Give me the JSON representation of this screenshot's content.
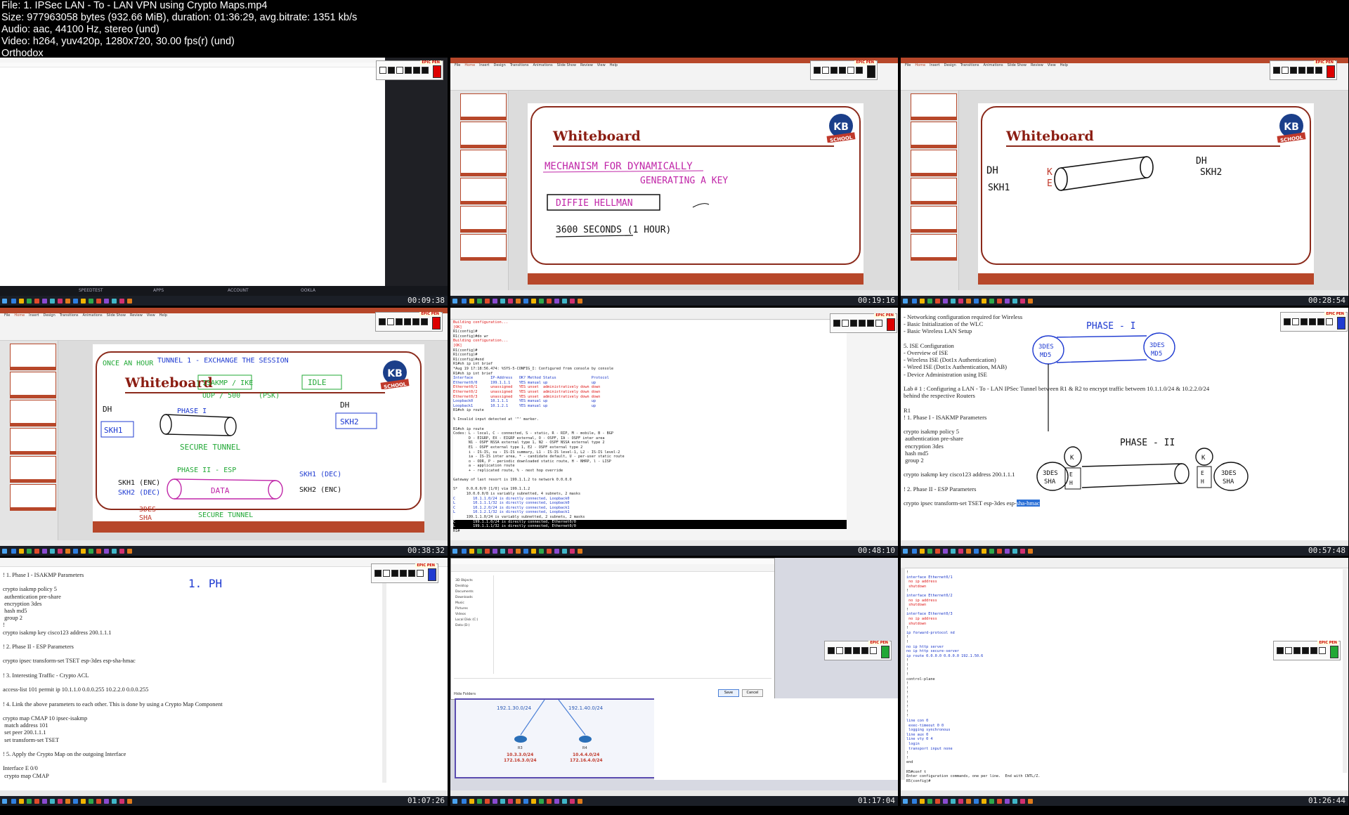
{
  "header": {
    "file_line": "File: 1. IPSec LAN - To - LAN VPN using Crypto Maps.mp4",
    "size_line": "Size: 977963058 bytes (932.66 MiB), duration: 01:36:29, avg.bitrate: 1351 kb/s",
    "audio_line": "Audio: aac, 44100 Hz, stereo (und)",
    "video_line": "Video: h264, yuv420p, 1280x720, 30.00 fps(r) (und)",
    "extra_line": "Orthodox"
  },
  "tiles": [
    {
      "timestamp": "00:09:38",
      "taskbar_labels": [
        "SPEEDTEST",
        "APPS",
        "ACCOUNT",
        "OOKLA"
      ]
    },
    {
      "timestamp": "00:19:16",
      "slide_title": "Whiteboard",
      "ink": [
        "MECHANISM FOR DYNAMICALLY",
        "GENERATING A KEY",
        "DIFFIE HELLMAN",
        "3600 SECONDS (1 HOUR)"
      ]
    },
    {
      "timestamp": "00:28:54",
      "slide_title": "Whiteboard",
      "ink": [
        "DH",
        "SKH1",
        "K",
        "E",
        "DH",
        "SKH2"
      ]
    },
    {
      "timestamp": "00:38:32",
      "slide_title": "Whiteboard",
      "ink": [
        "ONCE AN HOUR",
        "TUNNEL 1 - EXCHANGE THE SESSION",
        "ISAKMP / IKE",
        "UDP / 500",
        "(PSK)",
        "IDLE",
        "DH",
        "SKH1",
        "PHASE I",
        "SECURE TUNNEL",
        "PHASE II - ESP",
        "SKH1 (ENC)",
        "SKH2 (DEC)",
        "DATA",
        "SECURE TUNNEL",
        "3DES",
        "SHA",
        "SKH1 (DEC)",
        "SKH2 (ENC)",
        "DH",
        "SKH2"
      ]
    },
    {
      "timestamp": "00:48:10",
      "cli": [
        "Building configuration...",
        "[OK]",
        "R1(config)#",
        "R1(config)#do wr",
        "Building configuration...",
        "[OK]",
        "R1(config)#",
        "R1(config)#",
        "R1(config)#end",
        "R1#sh ip int brief",
        "*Aug 19 17:18:56.474: %SYS-5-CONFIG_I: Configured from console by console",
        "R1#sh ip int brief",
        "Interface        IP-Address   OK? Method Status                Protocol",
        "Ethernet0/0      199.1.1.1    YES manual up                    up",
        "Ethernet0/1      unassigned   YES unset  administratively down down",
        "Ethernet0/2      unassigned   YES unset  administratively down down",
        "Ethernet0/3      unassigned   YES unset  administratively down down",
        "Loopback0        10.1.1.1     YES manual up                    up",
        "Loopback1        10.1.2.1     YES manual up                    up",
        "R1#sh ip route",
        "",
        "% Invalid input detected at '^' marker.",
        "",
        "R1#sh ip route",
        "Codes: L - local, C - connected, S - static, R - RIP, M - mobile, B - BGP",
        "       D - EIGRP, EX - EIGRP external, O - OSPF, IA - OSPF inter area",
        "       N1 - OSPF NSSA external type 1, N2 - OSPF NSSA external type 2",
        "       E1 - OSPF external type 1, E2 - OSPF external type 2",
        "       i - IS-IS, su - IS-IS summary, L1 - IS-IS level-1, L2 - IS-IS level-2",
        "       ia - IS-IS inter area, * - candidate default, U - per-user static route",
        "       o - ODR, P - periodic downloaded static route, H - NHRP, l - LISP",
        "       a - application route",
        "       + - replicated route, % - next hop override",
        "",
        "Gateway of last resort is 199.1.1.2 to network 0.0.0.0",
        "",
        "S*    0.0.0.0/0 [1/0] via 199.1.1.2",
        "      10.0.0.0/8 is variably subnetted, 4 subnets, 2 masks",
        "C        10.1.1.0/24 is directly connected, Loopback0",
        "L        10.1.1.1/32 is directly connected, Loopback0",
        "C        10.1.2.0/24 is directly connected, Loopback1",
        "L        10.1.2.1/32 is directly connected, Loopback1",
        "      199.1.1.0/24 is variably subnetted, 2 subnets, 2 masks",
        "C        199.1.1.0/24 is directly connected, Ethernet0/0",
        "L        199.1.1.1/32 is directly connected, Ethernet0/0",
        "R1#"
      ]
    },
    {
      "timestamp": "00:57:48",
      "doc": [
        "- Networking configuration required for Wireless",
        "- Basic Initialization of the WLC",
        "- Basic Wireless LAN Setup",
        "",
        "5. ISE Configuration",
        "- Overview of ISE",
        "- Wireless ISE (Dot1x Authentication)",
        "- Wired ISE (Dot1x Authentication, MAB)",
        "- Device Administration using ISE",
        "",
        "Lab # 1 : Configuring a LAN - To - LAN IPSec Tunnel between R1 & R2 to encrypt traffic between 10.1.1.0/24 & 10.2.2.0/24",
        "behind the respective Routers",
        "",
        "R1",
        "! 1. Phase I - ISAKMP Parameters",
        "",
        "crypto isakmp policy 5",
        " authentication pre-share",
        " encryption 3des",
        " hash md5",
        " group 2",
        "",
        "crypto isakmp key cisco123 address 200.1.1.1",
        "",
        "! 2. Phase II - ESP Parameters",
        "",
        "crypto ipsec transform-set TSET esp-3des esp-"
      ],
      "doc_highlight": "sha-hmac",
      "ink": [
        "PHASE - I",
        "3DES",
        "MD5",
        "3DES",
        "MD5",
        "PHASE - II",
        "K",
        "E",
        "H",
        "3DES",
        "SHA",
        "K",
        "E",
        "H",
        "3DES",
        "SHA"
      ]
    },
    {
      "timestamp": "01:07:26",
      "doc": [
        "! 1. Phase I - ISAKMP Parameters",
        "",
        "crypto isakmp policy 5",
        " authentication pre-share",
        " encryption 3des",
        " hash md5",
        " group 2",
        "!",
        "crypto isakmp key cisco123 address 200.1.1.1",
        "",
        "! 2. Phase II - ESP Parameters",
        "",
        "crypto ipsec transform-set TSET esp-3des esp-sha-hmac",
        "",
        "! 3. Interesting Traffic - Crypto ACL",
        "",
        "access-list 101 permit ip 10.1.1.0 0.0.0.255 10.2.2.0 0.0.0.255",
        "",
        "! 4. Link the above parameters to each other. This is done by using a Crypto Map Component",
        "",
        "crypto map CMAP 10 ipsec-isakmp",
        " match address 101",
        " set peer 200.1.1.1",
        " set transform-set TSET",
        "",
        "! 5. Apply the Crypto Map on the outgoing Interface",
        "",
        "Interface E 0/0",
        " crypto map CMAP"
      ],
      "ink": [
        "1. PH"
      ]
    },
    {
      "timestamp": "01:17:04",
      "dialog_folders": [
        "3D Objects",
        "Desktop",
        "Documents",
        "Downloads",
        "Music",
        "Pictures",
        "Videos",
        "Local Disk (C:)",
        "Data (D:)"
      ],
      "dialog_buttons": [
        "Save",
        "Cancel"
      ],
      "dialog_hide": "Hide Folders",
      "topology": {
        "link_left": "192.1.30.0/24",
        "link_right": "192.1.40.0/24",
        "router_left": "R3",
        "router_right": "R4",
        "lan_left": [
          "10.3.3.0/24",
          "172.16.3.0/24"
        ],
        "lan_right": [
          "10.4.4.0/24",
          "172.16.4.0/24"
        ]
      }
    },
    {
      "timestamp": "01:26:44",
      "cli": [
        "!",
        "interface Ethernet0/1",
        " no ip address",
        " shutdown",
        "!",
        "interface Ethernet0/2",
        " no ip address",
        " shutdown",
        "!",
        "interface Ethernet0/3",
        " no ip address",
        " shutdown",
        "!",
        "ip forward-protocol nd",
        "!",
        "!",
        "no ip http server",
        "no ip http secure-server",
        "ip route 0.0.0.0 0.0.0.0 192.1.50.6",
        "!",
        "!",
        "!",
        "!",
        "control-plane",
        "!",
        "!",
        "!",
        "!",
        "!",
        "!",
        "!",
        "!",
        "line con 0",
        " exec-timeout 0 0",
        " logging synchronous",
        "line aux 0",
        "line vty 0 4",
        " login",
        " transport input none",
        "!",
        "!",
        "end",
        "",
        "R5#conf t",
        "Enter configuration commands, one per line.  End with CNTL/Z.",
        "R5(config)#"
      ]
    }
  ],
  "colors": {
    "ppt_red": "#b7472a",
    "ink_magenta": "#c026a8",
    "ink_green": "#22a836",
    "ink_blue": "#1f3bd1",
    "ink_black": "#111111"
  },
  "icons": [
    "pen-toolbar-icon",
    "windows-start-icon",
    "kb-school-logo"
  ],
  "logo_text": {
    "line1": "KB",
    "line2": "SCHOOL"
  },
  "pen_label": "EPIC PEN"
}
